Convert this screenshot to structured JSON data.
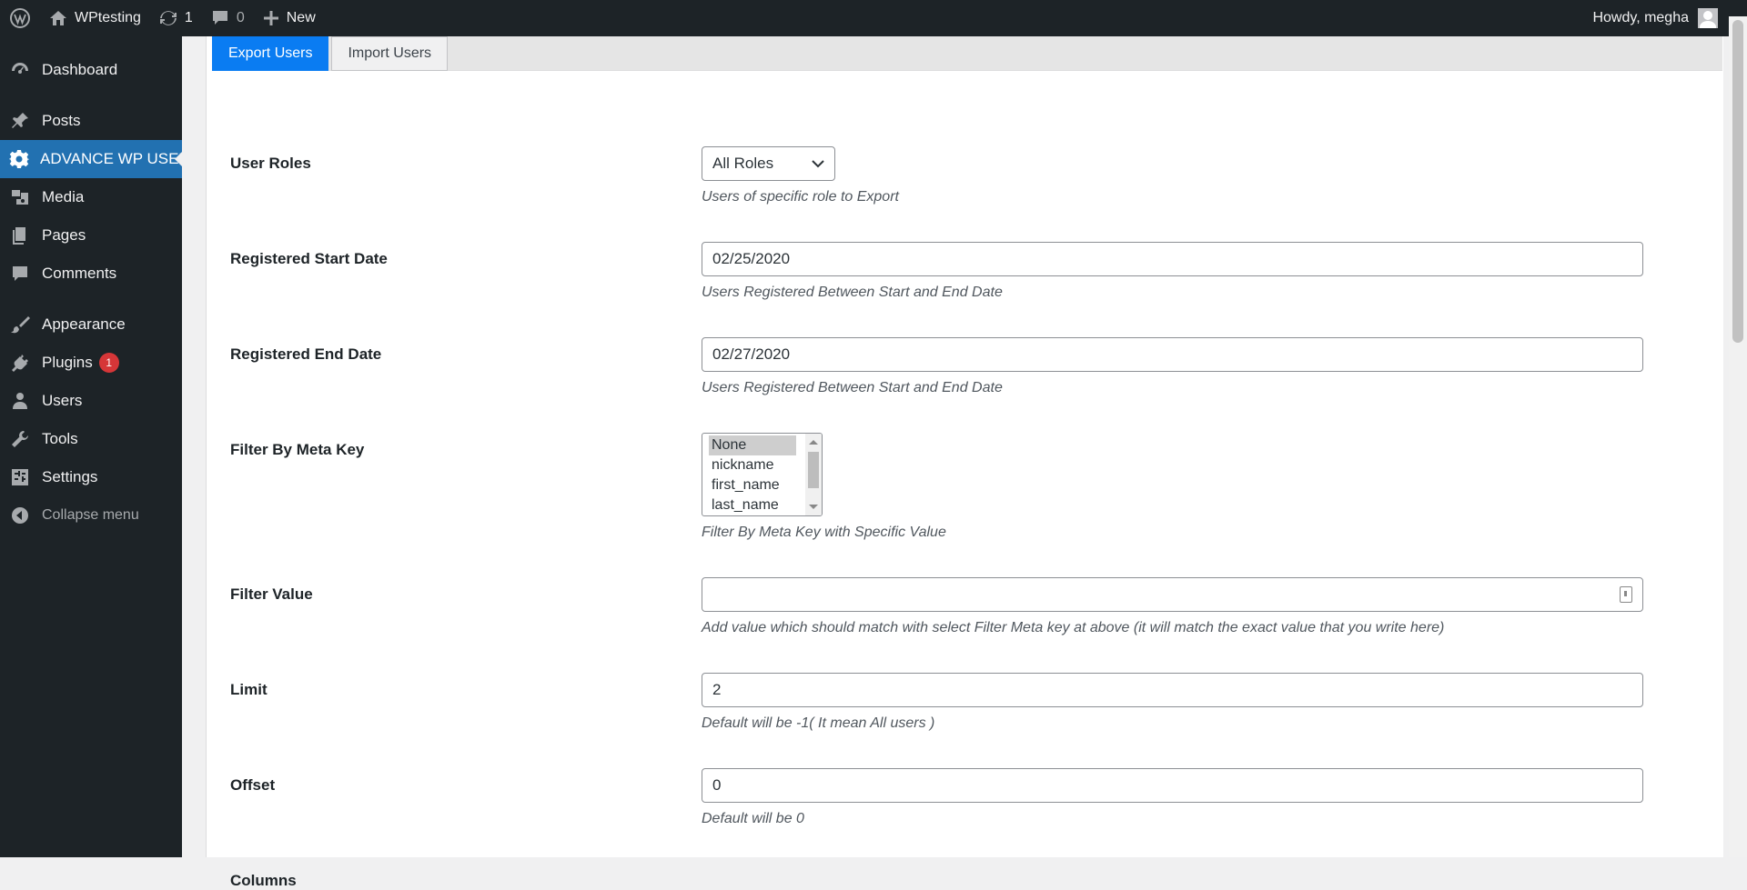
{
  "adminbar": {
    "site_name": "WPtesting",
    "updates_count": "1",
    "comments_count": "0",
    "new_label": "New",
    "howdy": "Howdy, megha"
  },
  "sidebar": {
    "items": [
      {
        "label": "Dashboard",
        "icon": "dashboard-icon"
      },
      {
        "label": "Posts",
        "icon": "pin-icon"
      },
      {
        "label": "ADVANCE WP USER",
        "icon": "gear-icon"
      },
      {
        "label": "Media",
        "icon": "media-icon"
      },
      {
        "label": "Pages",
        "icon": "pages-icon"
      },
      {
        "label": "Comments",
        "icon": "comment-icon"
      },
      {
        "label": "Appearance",
        "icon": "brush-icon"
      },
      {
        "label": "Plugins",
        "icon": "plug-icon",
        "badge": "1"
      },
      {
        "label": "Users",
        "icon": "user-icon"
      },
      {
        "label": "Tools",
        "icon": "wrench-icon"
      },
      {
        "label": "Settings",
        "icon": "settings-icon"
      }
    ],
    "collapse_label": "Collapse menu"
  },
  "tabs": {
    "export": "Export Users",
    "import": "Import Users"
  },
  "form": {
    "user_roles": {
      "label": "User Roles",
      "value": "All Roles",
      "desc": "Users of specific role to Export"
    },
    "start_date": {
      "label": "Registered Start Date",
      "value": "02/25/2020",
      "desc": "Users Registered Between Start and End Date"
    },
    "end_date": {
      "label": "Registered End Date",
      "value": "02/27/2020",
      "desc": "Users Registered Between Start and End Date"
    },
    "meta_key": {
      "label": "Filter By Meta Key",
      "options": [
        "None",
        "nickname",
        "first_name",
        "last_name"
      ],
      "selected": "None",
      "desc": "Filter By Meta Key with Specific Value"
    },
    "filter_value": {
      "label": "Filter Value",
      "value": "",
      "desc": "Add value which should match with select Filter Meta key at above (it will match the exact value that you write here)"
    },
    "limit": {
      "label": "Limit",
      "value": "2",
      "desc": "Default will be -1( It mean All users )"
    },
    "offset": {
      "label": "Offset",
      "value": "0",
      "desc": "Default will be 0"
    },
    "columns": {
      "label": "Columns"
    }
  },
  "colors": {
    "adminbar_bg": "#1d2327",
    "accent": "#2271b1",
    "tab_active": "#0a7cf2",
    "badge": "#d63638"
  }
}
